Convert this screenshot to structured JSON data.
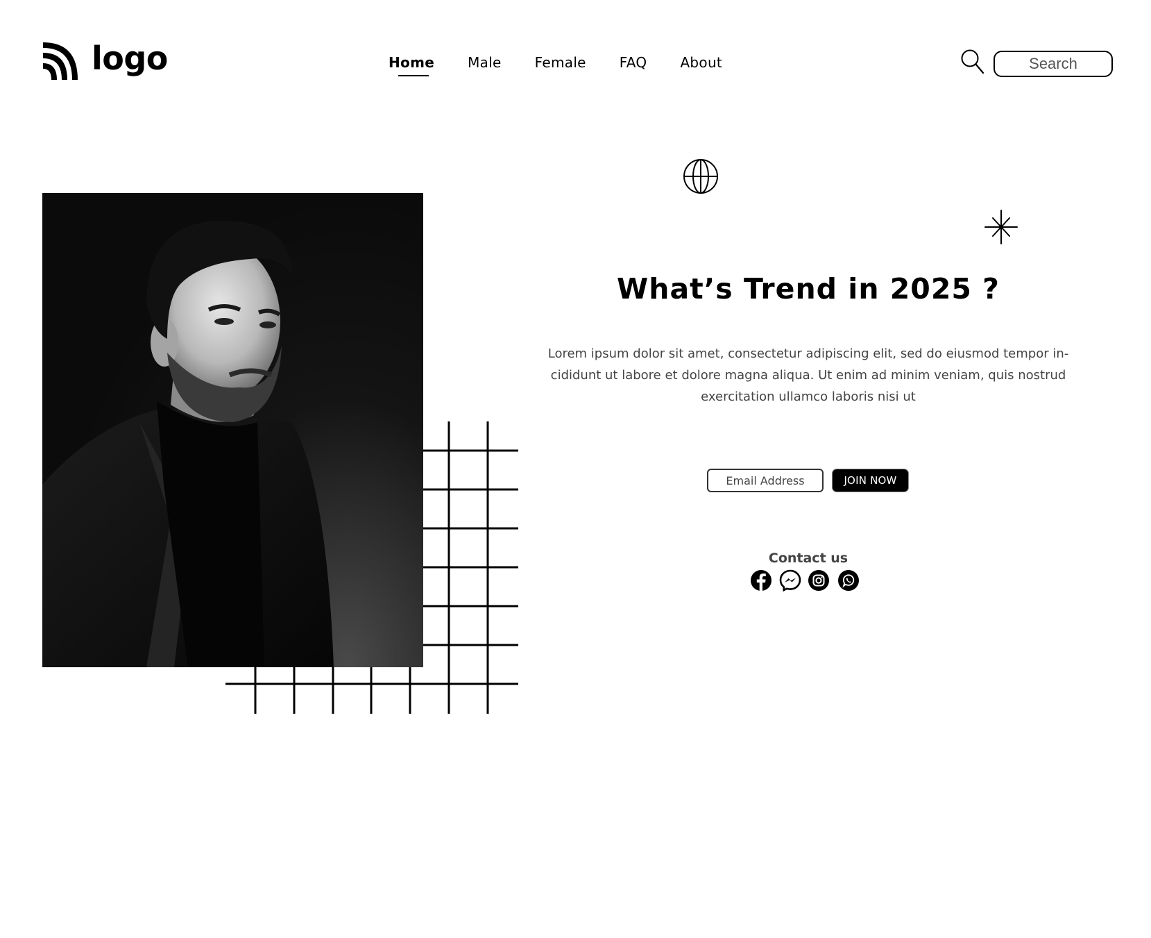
{
  "header": {
    "logo_text": "logo",
    "nav": [
      {
        "label": "Home",
        "active": true
      },
      {
        "label": "Male",
        "active": false
      },
      {
        "label": "Female",
        "active": false
      },
      {
        "label": "FAQ",
        "active": false
      },
      {
        "label": "About",
        "active": false
      }
    ],
    "search": {
      "placeholder": "Search",
      "icon": "search-icon"
    }
  },
  "hero": {
    "image": {
      "icon": "portrait-photo",
      "alt_subject": "black and white portrait of a man in a dark turtleneck and blazer"
    },
    "decor_icons": [
      "globe-icon",
      "sparkle-icon"
    ],
    "headline": "What’s Trend in 2025 ?",
    "description": "Lorem ipsum dolor sit amet, consectetur adipiscing elit, sed do eiusmod tempor in-cididunt ut labore et dolore magna aliqua. Ut enim ad minim veniam, quis nostrud exercitation ullamco laboris nisi ut",
    "signup": {
      "email_placeholder": "Email Address",
      "button_label": "JOIN NOW"
    },
    "contact": {
      "title": "Contact us",
      "socials": [
        "facebook-icon",
        "messenger-icon",
        "instagram-icon",
        "whatsapp-icon"
      ]
    }
  },
  "colors": {
    "background": "#ffffff",
    "primary": "#000000",
    "body_text": "#444444"
  }
}
